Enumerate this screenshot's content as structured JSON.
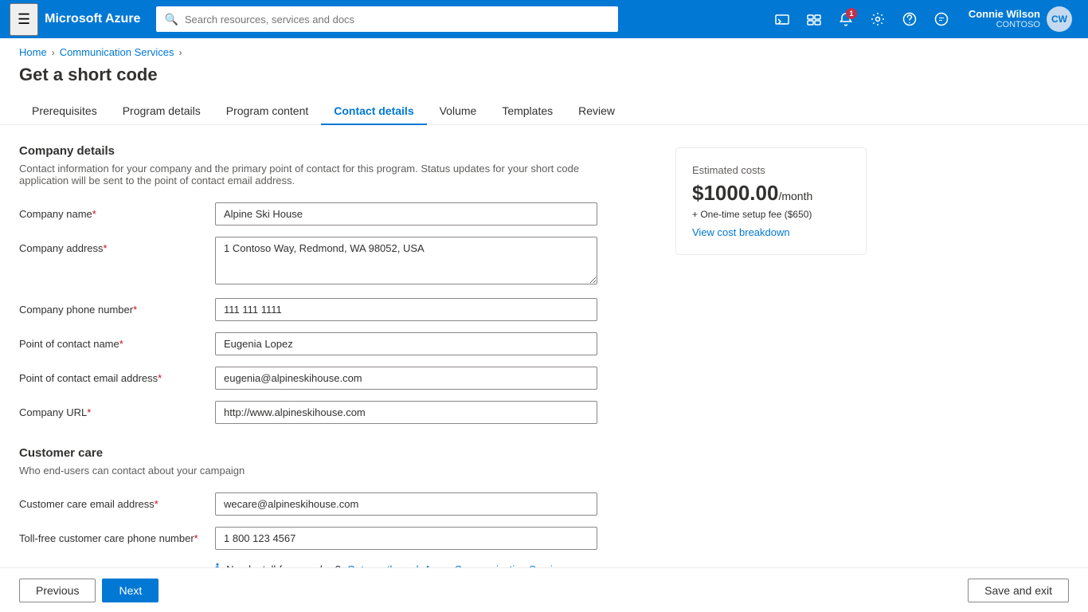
{
  "topnav": {
    "hamburger_icon": "☰",
    "brand": "Microsoft Azure",
    "search_placeholder": "Search resources, services and docs",
    "icons": [
      {
        "name": "cloud-shell-icon",
        "symbol": "⬛",
        "badge": null
      },
      {
        "name": "feedback-icon",
        "symbol": "💬",
        "badge": null
      },
      {
        "name": "notifications-icon",
        "symbol": "🔔",
        "badge": "1"
      },
      {
        "name": "settings-icon",
        "symbol": "⚙",
        "badge": null
      },
      {
        "name": "help-icon",
        "symbol": "?",
        "badge": null
      },
      {
        "name": "smiley-icon",
        "symbol": "🙂",
        "badge": null
      }
    ],
    "user": {
      "name": "Connie Wilson",
      "org": "CONTOSO",
      "avatar_initials": "CW"
    }
  },
  "breadcrumb": {
    "home": "Home",
    "service": "Communication Services"
  },
  "page": {
    "title": "Get a short code"
  },
  "tabs": [
    {
      "label": "Prerequisites",
      "active": false
    },
    {
      "label": "Program details",
      "active": false
    },
    {
      "label": "Program content",
      "active": false
    },
    {
      "label": "Contact details",
      "active": true
    },
    {
      "label": "Volume",
      "active": false
    },
    {
      "label": "Templates",
      "active": false
    },
    {
      "label": "Review",
      "active": false
    }
  ],
  "company_details": {
    "section_title": "Company details",
    "section_desc": "Contact information for your company and the primary point of contact for this program. Status updates for your short code application will be sent to the point of contact email address.",
    "fields": [
      {
        "label": "Company name",
        "required": true,
        "name": "company-name-input",
        "value": "Alpine Ski House",
        "type": "text",
        "multiline": false
      },
      {
        "label": "Company address",
        "required": true,
        "name": "company-address-input",
        "value": "1 Contoso Way, Redmond, WA 98052, USA",
        "type": "text",
        "multiline": true
      },
      {
        "label": "Company phone number",
        "required": true,
        "name": "company-phone-input",
        "value": "111 111 1111",
        "type": "text",
        "multiline": false
      },
      {
        "label": "Point of contact name",
        "required": true,
        "name": "contact-name-input",
        "value": "Eugenia Lopez",
        "type": "text",
        "multiline": false
      },
      {
        "label": "Point of contact email address",
        "required": true,
        "name": "contact-email-input",
        "value": "eugenia@alpineskihouse.com",
        "type": "text",
        "multiline": false
      },
      {
        "label": "Company URL",
        "required": true,
        "name": "company-url-input",
        "value": "http://www.alpineskihouse.com",
        "type": "text",
        "multiline": false
      }
    ]
  },
  "customer_care": {
    "section_title": "Customer care",
    "section_desc": "Who end-users can contact about your campaign",
    "fields": [
      {
        "label": "Customer care email address",
        "required": true,
        "name": "care-email-input",
        "value": "wecare@alpineskihouse.com",
        "type": "text",
        "multiline": false
      },
      {
        "label": "Toll-free customer care phone number",
        "required": true,
        "name": "care-phone-input",
        "value": "1 800 123 4567",
        "type": "text",
        "multiline": false
      }
    ],
    "info_text": "Need a toll-free number?",
    "info_link": "Get one through Azure Communication Services"
  },
  "cost_panel": {
    "label": "Estimated costs",
    "amount": "$1000.00",
    "period": "/month",
    "onetime": "+ One-time setup fee ($650)",
    "breakdown_link": "View cost breakdown"
  },
  "bottom_bar": {
    "previous_label": "Previous",
    "next_label": "Next",
    "save_exit_label": "Save and exit"
  }
}
